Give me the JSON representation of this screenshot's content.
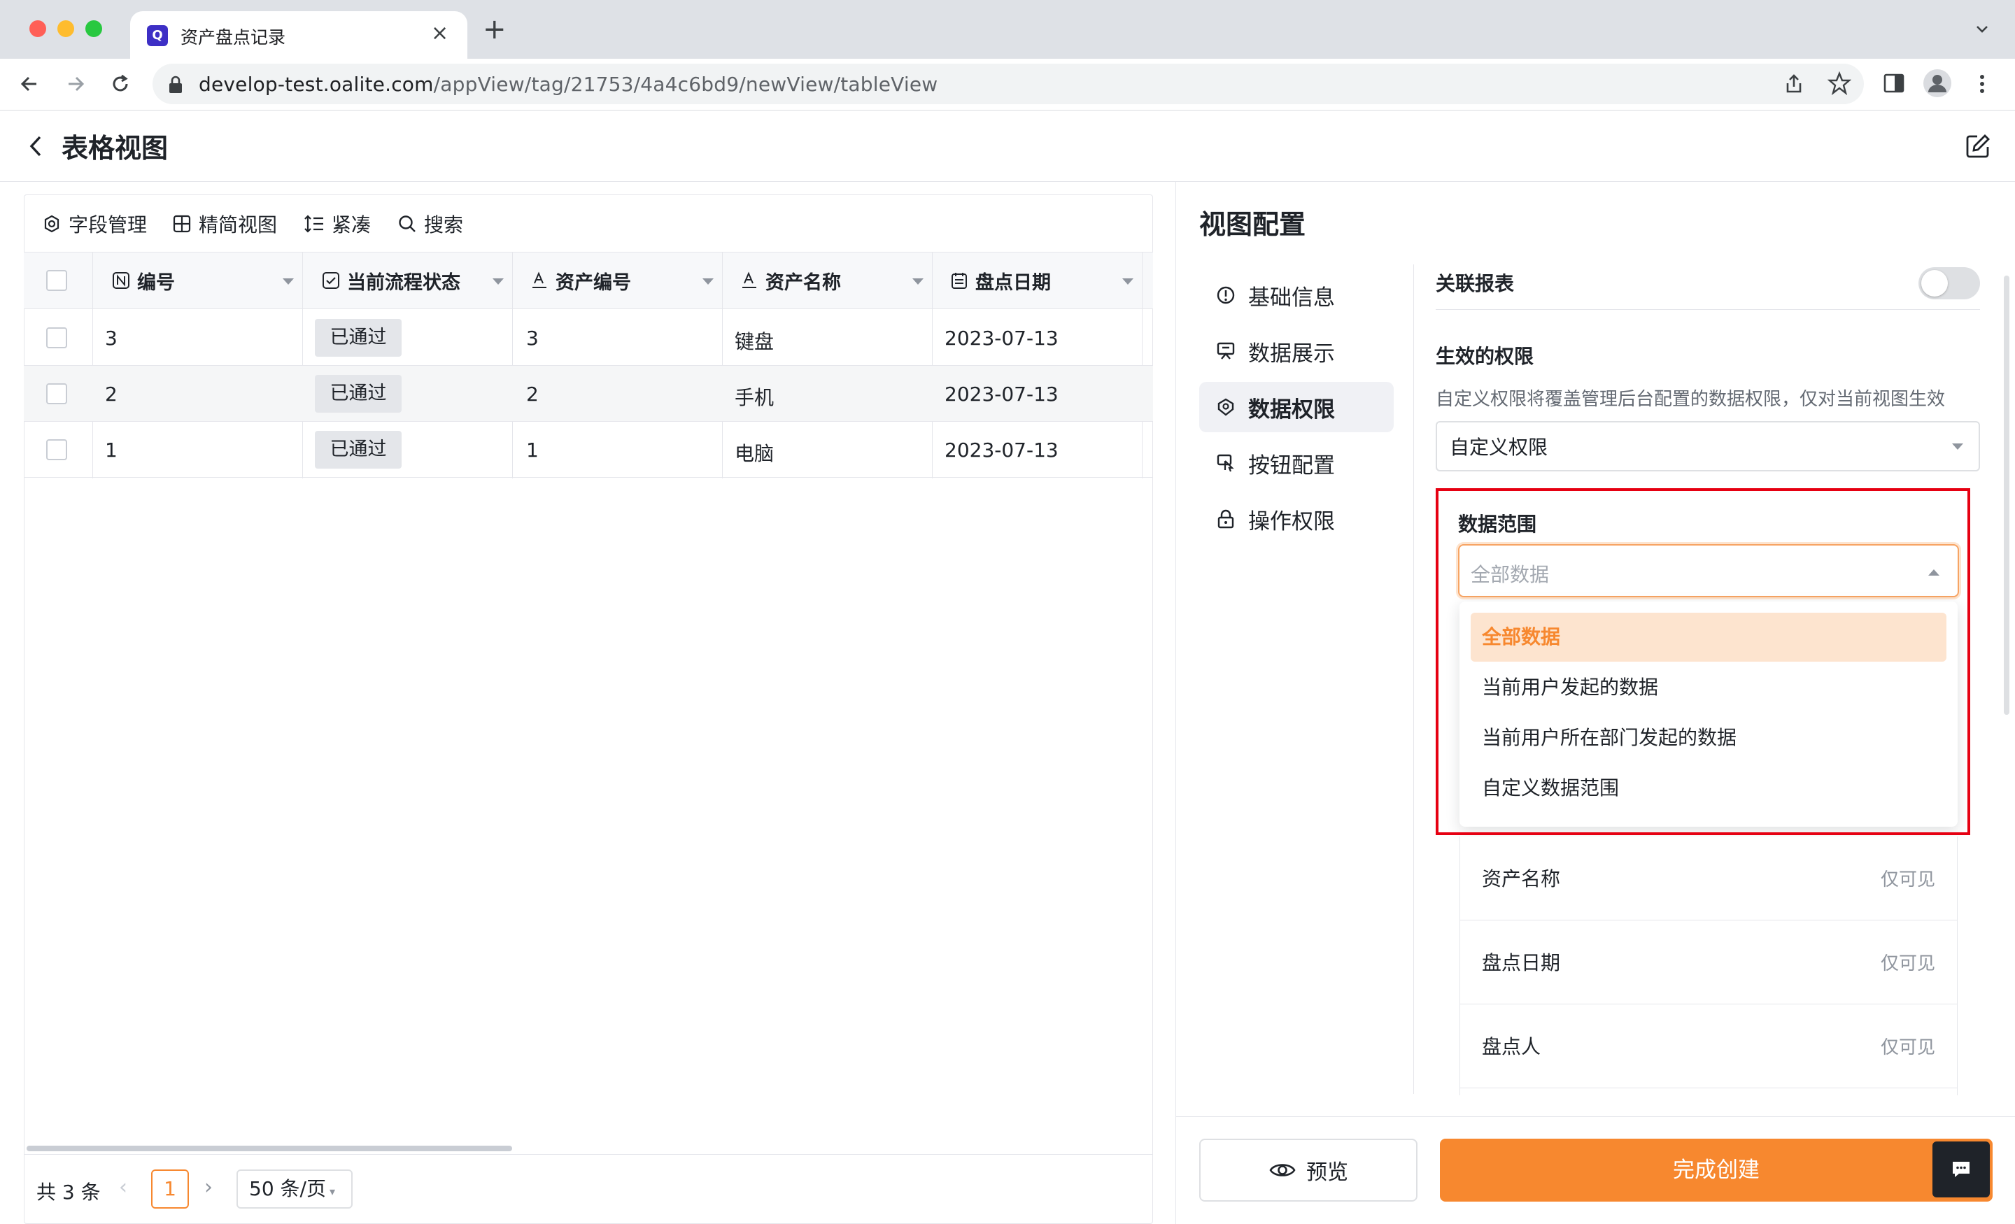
{
  "browser": {
    "tab_title": "资产盘点记录",
    "tab_favicon_letter": "Q",
    "url_host": "develop-test.oalite.com",
    "url_path": "/appView/tag/21753/4a4c6bd9/newView/tableView",
    "traffic_colors": [
      "#ff5f57",
      "#febc2e",
      "#28c840"
    ]
  },
  "header": {
    "title": "表格视图"
  },
  "table_toolbar": {
    "fields_label": "字段管理",
    "simple_view_label": "精简视图",
    "compact_label": "紧凑",
    "search_label": "搜索"
  },
  "table": {
    "columns": [
      "编号",
      "当前流程状态",
      "资产编号",
      "资产名称",
      "盘点日期"
    ],
    "rows": [
      {
        "id": "3",
        "status": "已通过",
        "asset_no": "3",
        "asset_name": "键盘",
        "date": "2023-07-13"
      },
      {
        "id": "2",
        "status": "已通过",
        "asset_no": "2",
        "asset_name": "手机",
        "date": "2023-07-13"
      },
      {
        "id": "1",
        "status": "已通过",
        "asset_no": "1",
        "asset_name": "电脑",
        "date": "2023-07-13"
      }
    ]
  },
  "pagination": {
    "total": "共 3 条",
    "current_page": "1",
    "page_size": "50 条/页"
  },
  "config": {
    "title": "视图配置",
    "nav": [
      "基础信息",
      "数据展示",
      "数据权限",
      "按钮配置",
      "操作权限"
    ],
    "active_nav": "数据权限",
    "linked_report_label": "关联报表",
    "linked_report_enabled": false,
    "permission_label": "生效的权限",
    "permission_hint": "自定义权限将覆盖管理后台配置的数据权限，仅对当前视图生效",
    "permission_value": "自定义权限",
    "scope_label": "数据范围",
    "scope_placeholder": "全部数据",
    "scope_options": [
      "全部数据",
      "当前用户发起的数据",
      "当前用户所在部门发起的数据",
      "自定义数据范围"
    ],
    "fields": [
      {
        "name": "资产名称",
        "perm": "仅可见"
      },
      {
        "name": "盘点日期",
        "perm": "仅可见"
      },
      {
        "name": "盘点人",
        "perm": "仅可见"
      }
    ],
    "preview_label": "预览",
    "create_label": "完成创建",
    "accent_color": "#f7882f",
    "highlight_color": "#e60012"
  }
}
